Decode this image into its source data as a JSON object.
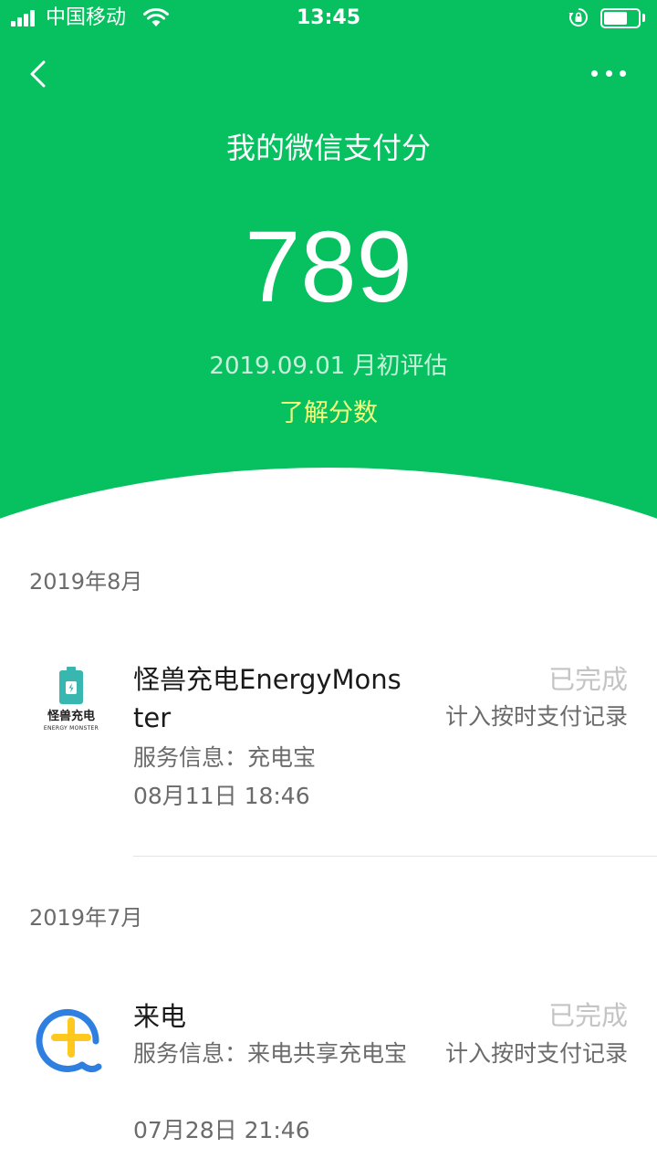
{
  "status_bar": {
    "carrier": "中国移动",
    "time": "13:45",
    "battery_level": 0.7
  },
  "header": {
    "title": "我的微信支付分",
    "score": "789",
    "evaluation": "2019.09.01 月初评估",
    "learn_link": "了解分数"
  },
  "sections": [
    {
      "month": "2019年8月",
      "records": [
        {
          "logo_icon": "energy-monster-logo",
          "logo_text": "怪兽充电",
          "logo_subtext": "ENERGY MONSTER",
          "name": "怪兽充电EnergyMonster",
          "service": "服务信息：充电宝",
          "time": "08月11日 18:46",
          "status": "已完成",
          "note": "计入按时支付记录"
        }
      ]
    },
    {
      "month": "2019年7月",
      "records": [
        {
          "logo_icon": "laidian-logo",
          "name": "来电",
          "service": "服务信息：来电共享充电宝",
          "time": "07月28日 21:46",
          "status": "已完成",
          "note": "计入按时支付记录"
        }
      ]
    }
  ],
  "colors": {
    "brand_green": "#07c160",
    "link_yellow": "#f4ff7a",
    "laidian_blue": "#2f7fe0",
    "laidian_yellow": "#ffc81e",
    "energy_teal": "#38b6b0"
  }
}
